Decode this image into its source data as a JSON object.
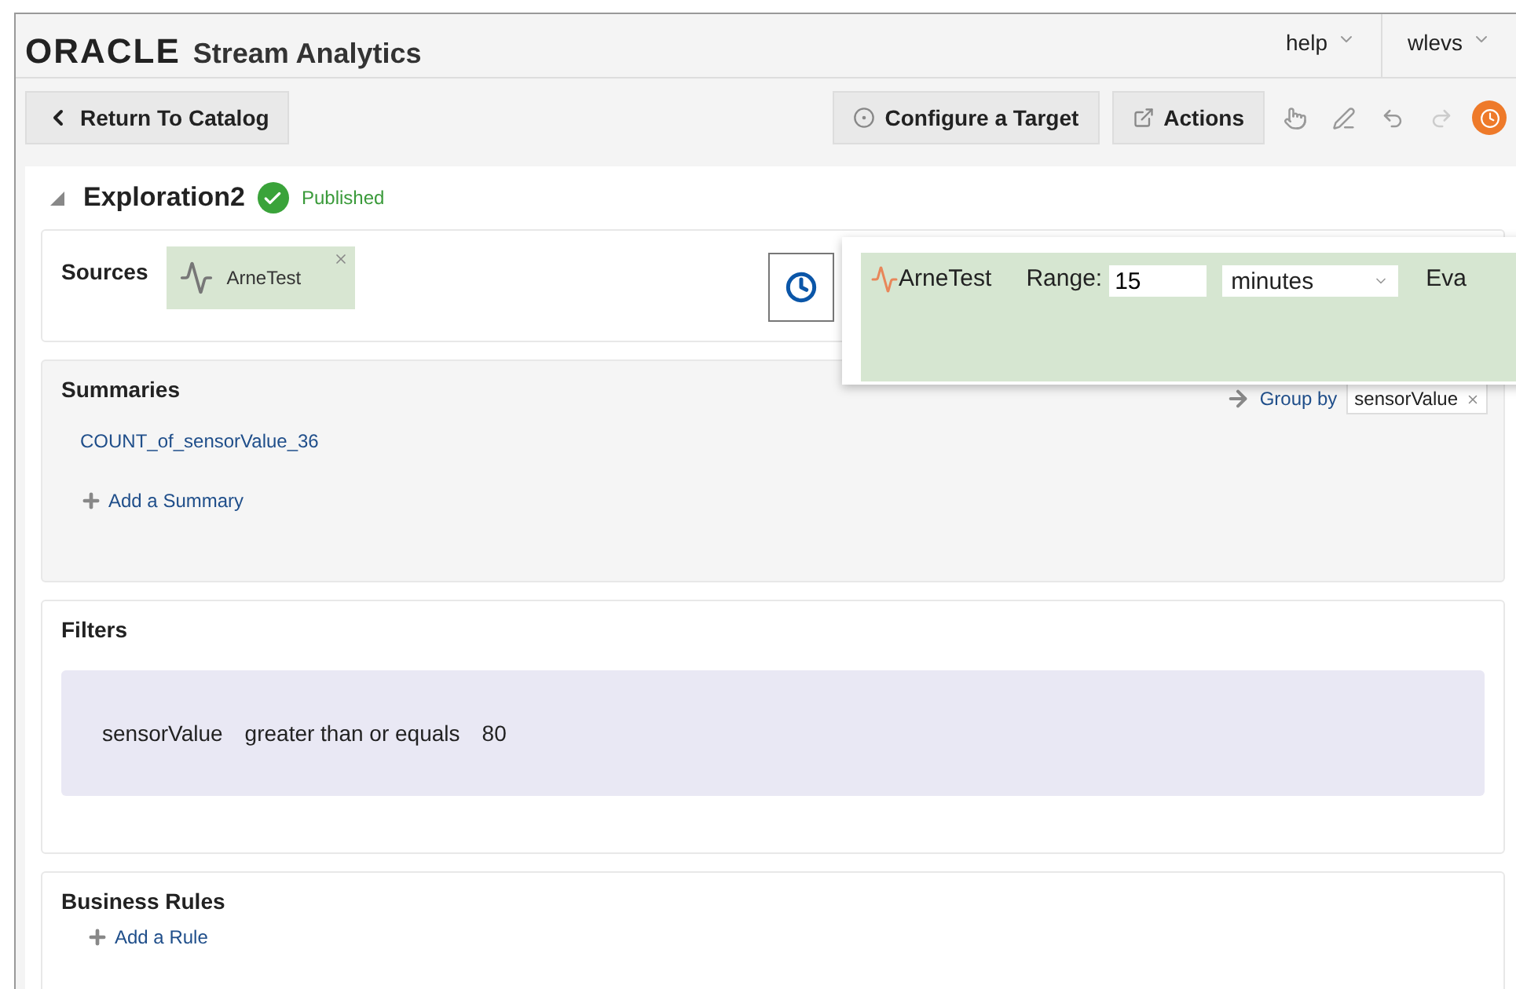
{
  "header": {
    "logo": "ORACLE",
    "product": "Stream Analytics",
    "menus": [
      {
        "label": "help"
      },
      {
        "label": "wlevs"
      }
    ]
  },
  "toolbar": {
    "back": "Return To Catalog",
    "configure": "Configure a Target",
    "actions": "Actions"
  },
  "exploration": {
    "title": "Exploration2",
    "status": "Published",
    "expanded": true
  },
  "sources": {
    "label": "Sources",
    "items": [
      {
        "name": "ArneTest"
      }
    ]
  },
  "window_popover": {
    "source": "ArneTest",
    "range_label": "Range:",
    "range_value": "15",
    "unit": "minutes",
    "next_label": "Eva"
  },
  "summaries": {
    "title": "Summaries",
    "items": [
      "COUNT_of_sensorValue_36"
    ],
    "add": "Add a Summary",
    "group_by": "Group by",
    "group_tags": [
      "sensorValue"
    ]
  },
  "filters": {
    "title": "Filters",
    "conditions": [
      {
        "field": "sensorValue",
        "operator": "greater than or equals",
        "value": "80"
      }
    ]
  },
  "business_rules": {
    "title": "Business Rules",
    "add": "Add a Rule"
  }
}
